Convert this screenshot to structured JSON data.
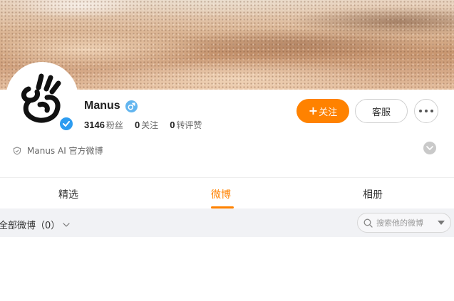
{
  "profile": {
    "name": "Manus",
    "stats": [
      {
        "value": "3146",
        "label": "粉丝"
      },
      {
        "value": "0",
        "label": "关注"
      },
      {
        "value": "0",
        "label": "转评赞"
      }
    ],
    "description": "Manus AI 官方微博"
  },
  "actions": {
    "follow_plus": "+",
    "follow_label": "关注",
    "service_label": "客服"
  },
  "tabs": [
    {
      "label": "精选"
    },
    {
      "label": "微博"
    },
    {
      "label": "相册"
    }
  ],
  "active_tab": "微博",
  "filter": {
    "label": "全部微博（0）"
  },
  "search": {
    "placeholder": "搜索他的微博"
  },
  "colors": {
    "accent": "#ff8200",
    "verified": "#2d9cf0",
    "gender": "#62b5ef"
  },
  "icons": [
    "manus-logo-icon",
    "verified-icon",
    "male-icon",
    "more-icon",
    "shield-icon",
    "chevron-down-icon",
    "search-icon"
  ]
}
